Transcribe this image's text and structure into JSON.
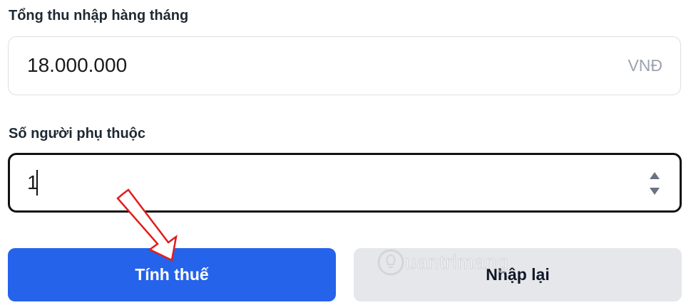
{
  "income": {
    "label": "Tổng thu nhập hàng tháng",
    "value": "18.000.000",
    "unit": "VNĐ"
  },
  "dependents": {
    "label": "Số người phụ thuộc",
    "value": "1"
  },
  "buttons": {
    "calculate": "Tính thuế",
    "reset": "Nhập lại"
  },
  "watermark": {
    "text": "uantrimang"
  },
  "colors": {
    "primary": "#2563eb",
    "secondary": "#e5e7eb",
    "annotation_arrow": "#e11d1d"
  }
}
